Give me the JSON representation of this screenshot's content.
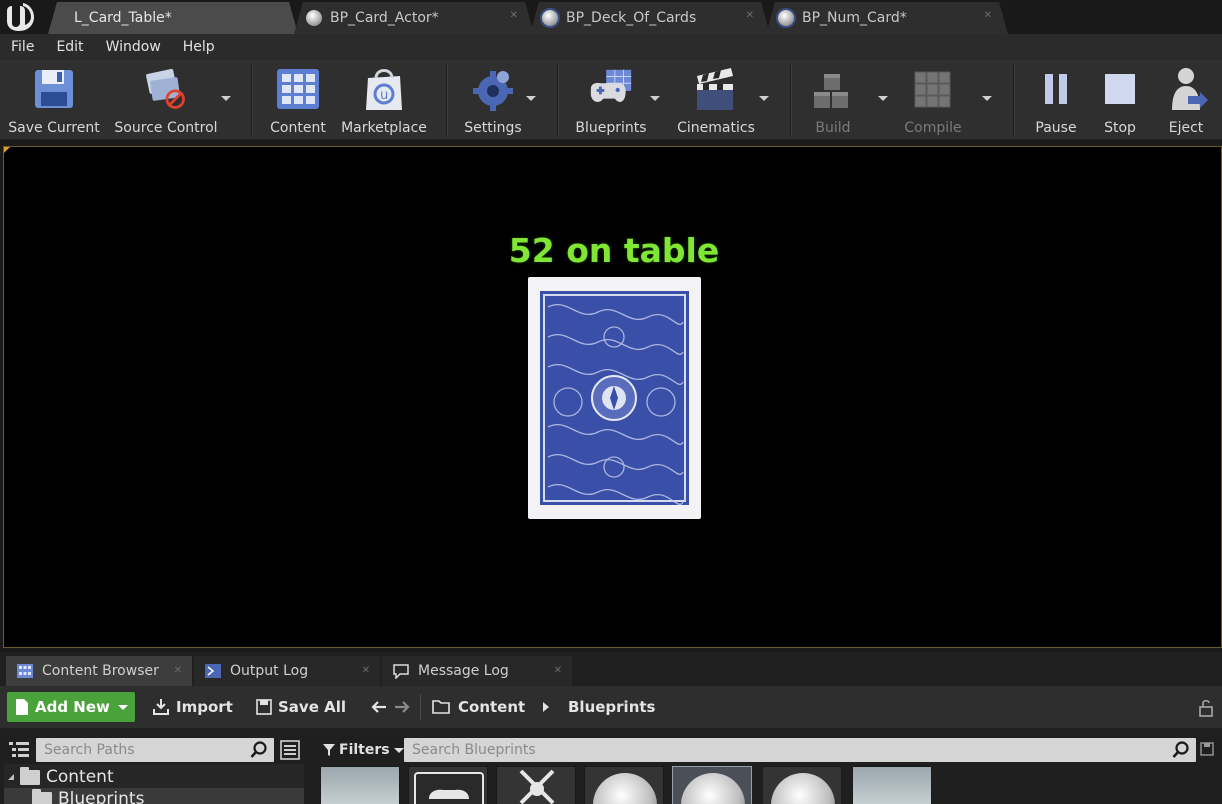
{
  "tabs": [
    {
      "label": "L_Card_Table*",
      "active": true
    },
    {
      "label": "BP_Card_Actor*",
      "active": false
    },
    {
      "label": "BP_Deck_Of_Cards",
      "active": false
    },
    {
      "label": "BP_Num_Card*",
      "active": false
    }
  ],
  "menu": [
    "File",
    "Edit",
    "Window",
    "Help"
  ],
  "toolbar": {
    "save_current": "Save Current",
    "source_control": "Source Control",
    "content": "Content",
    "marketplace": "Marketplace",
    "settings": "Settings",
    "blueprints": "Blueprints",
    "cinematics": "Cinematics",
    "build": "Build",
    "compile": "Compile",
    "pause": "Pause",
    "stop": "Stop",
    "eject": "Eject"
  },
  "viewport": {
    "score_text": "52 on table",
    "score_color": "#7fe634",
    "card_back_color": "#3a4fa8"
  },
  "panels": [
    "Content Browser",
    "Output Log",
    "Message Log"
  ],
  "content_browser": {
    "add_new": "Add New",
    "import": "Import",
    "save_all": "Save All",
    "path": [
      "Content",
      "Blueprints"
    ],
    "search_paths_placeholder": "Search Paths",
    "filters": "Filters",
    "search_blueprints_placeholder": "Search Blueprints",
    "tree": [
      "Content",
      "Blueprints"
    ]
  },
  "colors": {
    "add_new_green": "#4aa33a",
    "viewport_border": "#6b5a2a"
  }
}
